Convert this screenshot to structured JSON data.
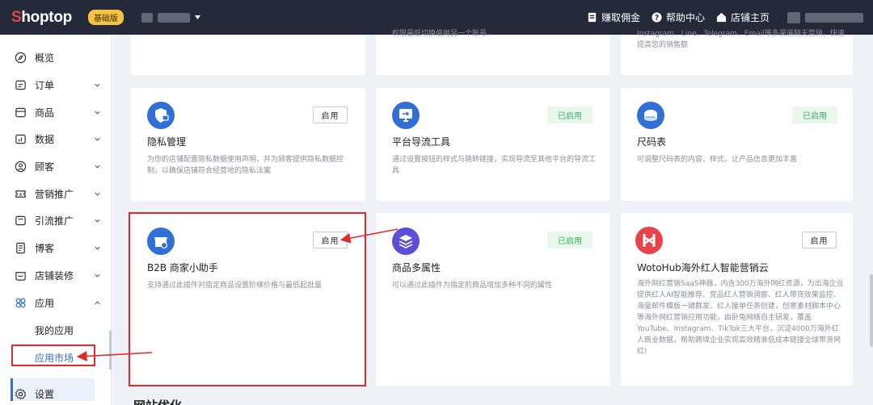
{
  "topbar": {
    "logo_prefix": "S",
    "logo_rest": "hoptop",
    "edition_badge": "基础版",
    "links": [
      {
        "label": "赚取佣金",
        "icon": "gift-card-icon"
      },
      {
        "label": "帮助中心",
        "icon": "help-circle-icon"
      },
      {
        "label": "店铺主页",
        "icon": "home-icon"
      }
    ]
  },
  "sidebar": {
    "items": [
      {
        "label": "概览",
        "icon": "compass-icon"
      },
      {
        "label": "订单",
        "icon": "order-icon"
      },
      {
        "label": "商品",
        "icon": "box-icon"
      },
      {
        "label": "数据",
        "icon": "chart-icon"
      },
      {
        "label": "顾客",
        "icon": "user-icon"
      },
      {
        "label": "营销推广",
        "icon": "ticket-icon"
      },
      {
        "label": "引流推广",
        "icon": "traffic-icon"
      },
      {
        "label": "博客",
        "icon": "document-icon"
      },
      {
        "label": "店铺装修",
        "icon": "store-decor-icon"
      },
      {
        "label": "应用",
        "icon": "apps-icon"
      }
    ],
    "sub_items": [
      {
        "label": "我的应用"
      },
      {
        "label": "应用市场"
      }
    ],
    "settings": {
      "label": "设置",
      "icon": "gear-icon"
    }
  },
  "top_partial": {
    "col2_desc": "权限最低切换使用另一个账号。",
    "col3_desc_line1": "Instagram、Line、Telegram、Email等多渠道聊天营销，快速",
    "col3_desc_line2": "提高您的销售额"
  },
  "cards_row1": [
    {
      "title": "隐私管理",
      "desc": "为你的店铺配置隐私数据使用声明，并为顾客提供隐私数据控制，以确保店铺符合经营地的隐私法案",
      "button": "启用",
      "state": "enable",
      "icon": "privacy-shield-icon",
      "color": "#2f6fd6"
    },
    {
      "title": "平台导流工具",
      "desc": "通过设置按钮的样式与跳转链接，实现导流至其他平台的导流工具",
      "button": "已启用",
      "state": "enabled",
      "icon": "monitor-icon",
      "color": "#2f6fd6"
    },
    {
      "title": "尺码表",
      "desc": "可调整尺码表的内容、样式，让产品信息更加丰富",
      "button": "已启用",
      "state": "enabled",
      "icon": "tape-measure-icon",
      "color": "#2f6fd6"
    }
  ],
  "cards_row2": [
    {
      "title": "B2B 商家小助手",
      "desc": "支持通过此插件对指定商品设置阶梯价格与最低起批量",
      "button": "启用",
      "state": "enable",
      "icon": "b2b-store-icon",
      "color": "#2f6fd6"
    },
    {
      "title": "商品多属性",
      "desc": "可以通过此插件为指定的商品增加多种不同的属性",
      "button": "已启用",
      "state": "enabled",
      "icon": "layers-icon",
      "color": "#5b4fd8"
    },
    {
      "title": "WotoHub海外红人智能营销云",
      "desc": "海外网红营销SaaS神器，内含300万海外网红资源，为出海企业提供红人AI智能推荐、竞品红人营销洞察、红人带货效果监控、海量邮件模板一键群发、红人接单任务创建，创意素材脚本中心等海外网红营销应用功能，由卧兔网络自主研发，覆盖YouTube、Instagram、TikTok三大平台，沉淀4000万海外红人商业数据，帮助跨境企业实现高效精准低成本链接全球带货网红!",
      "button": "启用",
      "state": "enable",
      "icon": "wotohub-logo-icon",
      "color": "#e8434a"
    }
  ],
  "section": {
    "title": "网站优化"
  }
}
